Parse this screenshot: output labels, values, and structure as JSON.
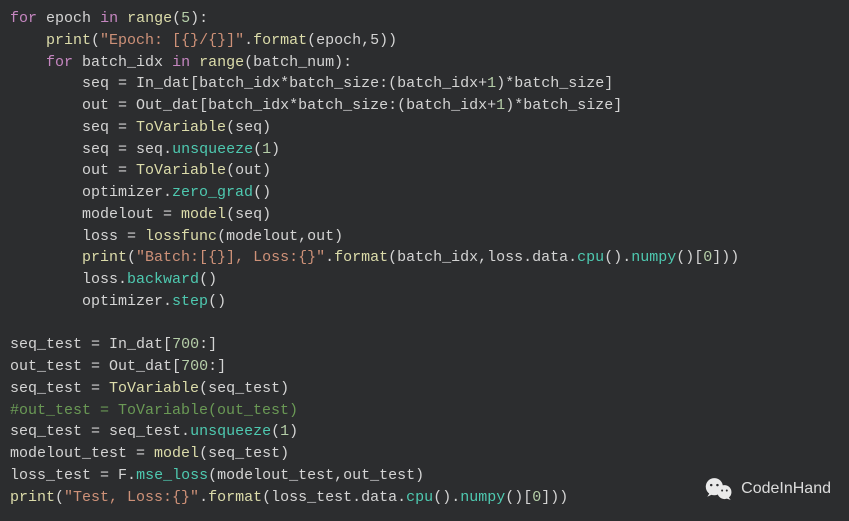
{
  "code": {
    "epochs": "5",
    "epoch_fmt": "\"Epoch: [{}/{}]\"",
    "epoch_args": "epoch,5",
    "batch_var": "batch_num",
    "slice_seq_lhs": "seq",
    "slice_out_lhs": "out",
    "in_dat": "In_dat",
    "out_dat": "Out_dat",
    "batch_idx": "batch_idx",
    "batch_size": "batch_size",
    "plus1": "1",
    "tovar": "ToVariable",
    "unsqueeze_arg": "1",
    "opt_zero": "zero_grad",
    "model": "model",
    "lossfunc": "lossfunc",
    "batch_fmt": "\"Batch:[{}], Loss:{}\"",
    "batch_args_a": "batch_idx",
    "batch_args_b": "loss.data.",
    "cpu": "cpu",
    "numpy": "numpy",
    "idx0": "0",
    "backward": "backward",
    "step": "step",
    "optimizer": "optimizer",
    "modelout": "modelout",
    "loss": "loss"
  },
  "test": {
    "seq_test": "seq_test",
    "out_test": "out_test",
    "in_slice": "700",
    "out_slice": "700",
    "comment": "#out_test = ToVariable(out_test)",
    "unsqueeze_arg": "1",
    "modelout_test": "modelout_test",
    "loss_test": "loss_test",
    "mse": "mse_loss",
    "F": "F",
    "test_fmt": "\"Test, Loss:{}\"",
    "idx0": "0"
  },
  "watermark": {
    "text": "CodeInHand"
  }
}
